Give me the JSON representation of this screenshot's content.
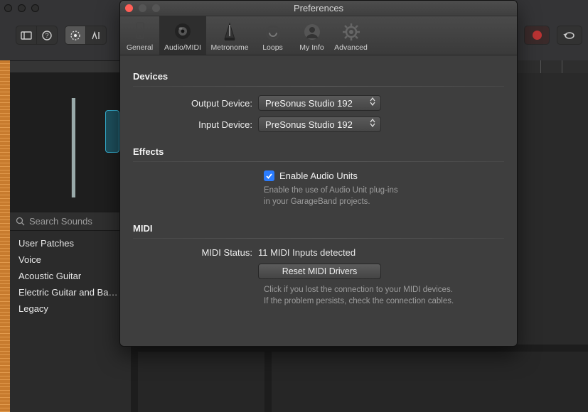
{
  "window": {
    "title": "Preferences"
  },
  "tabs": {
    "general": "General",
    "audio_midi": "Audio/MIDI",
    "metronome": "Metronome",
    "loops": "Loops",
    "my_info": "My Info",
    "advanced": "Advanced"
  },
  "sections": {
    "devices": "Devices",
    "effects": "Effects",
    "midi": "MIDI"
  },
  "devices": {
    "output_label": "Output Device:",
    "output_value": "PreSonus Studio 192",
    "input_label": "Input Device:",
    "input_value": "PreSonus Studio 192"
  },
  "effects": {
    "checkbox_label": "Enable Audio Units",
    "checked": true,
    "hint_line1": "Enable the use of Audio Unit plug-ins",
    "hint_line2": "in your GarageBand projects."
  },
  "midi": {
    "status_label": "MIDI Status:",
    "status_value": "11 MIDI Inputs detected",
    "reset_button": "Reset MIDI Drivers",
    "hint_line1": "Click if you lost the connection to your MIDI devices.",
    "hint_line2": "If the problem persists, check the connection cables."
  },
  "background": {
    "search_placeholder": "Search Sounds",
    "library_items": [
      "User Patches",
      "Voice",
      "Acoustic Guitar",
      "Electric Guitar and Ba…",
      "Legacy"
    ]
  }
}
